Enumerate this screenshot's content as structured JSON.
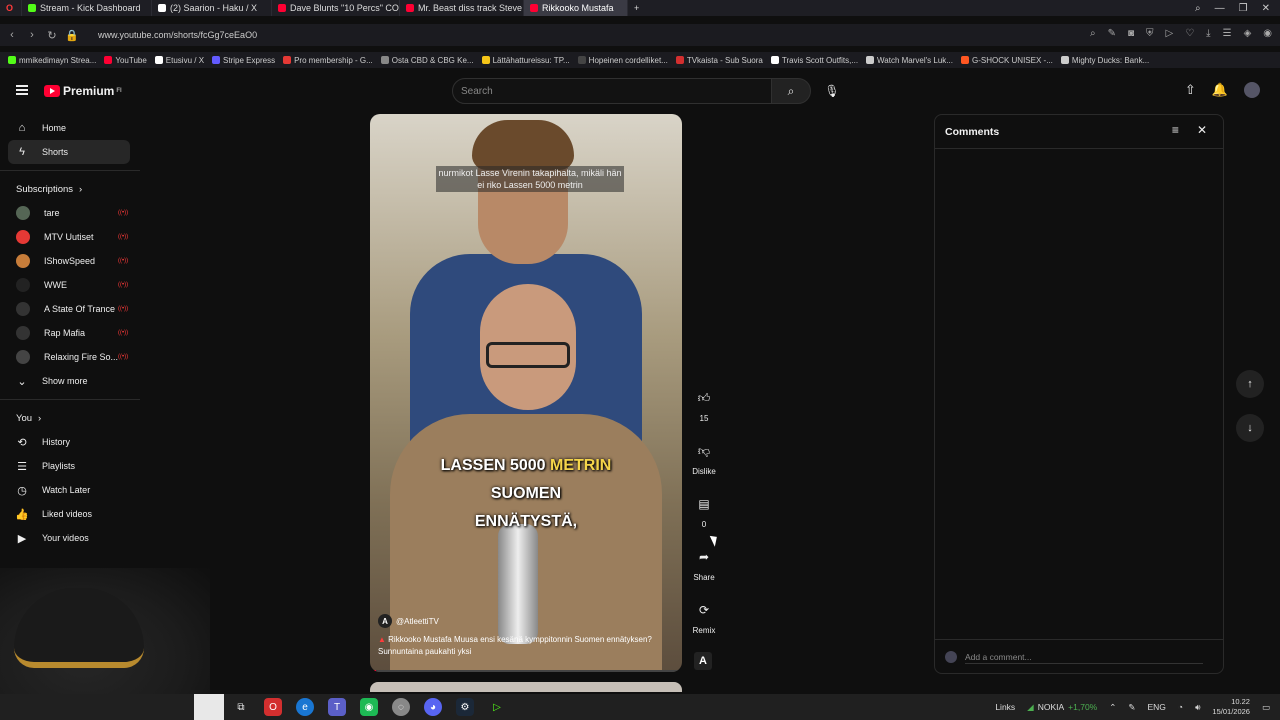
{
  "browser": {
    "tabs": [
      {
        "label": "Stream - Kick Dashboard",
        "color": "#53fc18"
      },
      {
        "label": "(2) Saarion - Haku / X",
        "color": "#ffffff"
      },
      {
        "label": "Dave Blunts \"10 Percs\" CO",
        "color": "#ff0033"
      },
      {
        "label": "Mr. Beast diss track Steve",
        "color": "#ff0033"
      },
      {
        "label": "Rikkooko Mustafa",
        "color": "#ff0033"
      }
    ],
    "url": "www.youtube.com/shorts/fcGg7ceEaO0",
    "bookmarks": [
      {
        "label": "mmikedimayn Strea...",
        "color": "#53fc18"
      },
      {
        "label": "YouTube",
        "color": "#ff0033"
      },
      {
        "label": "Etusivu / X",
        "color": "#ffffff"
      },
      {
        "label": "Stripe Express",
        "color": "#635bff"
      },
      {
        "label": "Pro membership - G...",
        "color": "#e53935"
      },
      {
        "label": "Osta CBD & CBG Ke...",
        "color": "#888888"
      },
      {
        "label": "Lättähattureissu: TP...",
        "color": "#f5c518"
      },
      {
        "label": "Hopeinen cordelliket...",
        "color": "#444444"
      },
      {
        "label": "TVkaista - Sub Suora",
        "color": "#d32f2f"
      },
      {
        "label": "Travis Scott Outfits,...",
        "color": "#ffffff"
      },
      {
        "label": "Watch Marvel's Luk...",
        "color": "#cccccc"
      },
      {
        "label": "G-SHOCK UNISEX -...",
        "color": "#ff5722"
      },
      {
        "label": "Mighty Ducks: Bank...",
        "color": "#cccccc"
      }
    ]
  },
  "header": {
    "logo_text": "Premium",
    "logo_sup": "FI",
    "search_placeholder": "Search"
  },
  "sidebar": {
    "main": [
      {
        "label": "Home",
        "icon": "home-icon",
        "glyph": "⌂"
      },
      {
        "label": "Shorts",
        "icon": "shorts-icon",
        "glyph": "ϟ"
      }
    ],
    "subscriptions_title": "Subscriptions",
    "subscriptions": [
      {
        "label": "tare",
        "color": "#556655"
      },
      {
        "label": "MTV Uutiset",
        "color": "#e53935"
      },
      {
        "label": "IShowSpeed",
        "color": "#c77d3a"
      },
      {
        "label": "WWE",
        "color": "#222222"
      },
      {
        "label": "A State Of Trance",
        "color": "#333333"
      },
      {
        "label": "Rap Mafia",
        "color": "#333333"
      },
      {
        "label": "Relaxing Fire So...",
        "color": "#444444"
      }
    ],
    "show_more": "Show more",
    "you_title": "You",
    "you": [
      {
        "label": "History",
        "icon": "history-icon",
        "glyph": "⟲"
      },
      {
        "label": "Playlists",
        "icon": "playlists-icon",
        "glyph": "☰"
      },
      {
        "label": "Watch Later",
        "icon": "watch-later-icon",
        "glyph": "◷"
      },
      {
        "label": "Liked videos",
        "icon": "liked-videos-icon",
        "glyph": "👍"
      },
      {
        "label": "Your videos",
        "icon": "your-videos-icon",
        "glyph": "▶"
      }
    ]
  },
  "short": {
    "caption_top": "nurmikot Lasse Virenin takapihalta, mikäli hän ei riko Lassen 5000 metrin",
    "subtitle_line1_a": "LASSEN 5000",
    "subtitle_line1_b": "METRIN",
    "subtitle_line2": "SUOMEN",
    "subtitle_line3": "ENNÄTYSTÄ,",
    "channel": "@AtleettiTV",
    "channel_initial": "A",
    "description": "Rikkooko Mustafa Muusa ensi kesänä kymppitonnin Suomen ennätyksen? Sunnuntaina paukahti yksi",
    "progress": 0.02
  },
  "actions": {
    "like_count": "15",
    "dislike_label": "Dislike",
    "comment_count": "0",
    "share_label": "Share",
    "remix_label": "Remix",
    "channel_badge": "A"
  },
  "comments": {
    "title": "Comments",
    "add_placeholder": "Add a comment..."
  },
  "taskbar": {
    "links_label": "Links",
    "stock_name": "NOKIA",
    "stock_change": "+1,70%",
    "language": "ENG",
    "time": "10.22",
    "date": "15/01/2026"
  }
}
